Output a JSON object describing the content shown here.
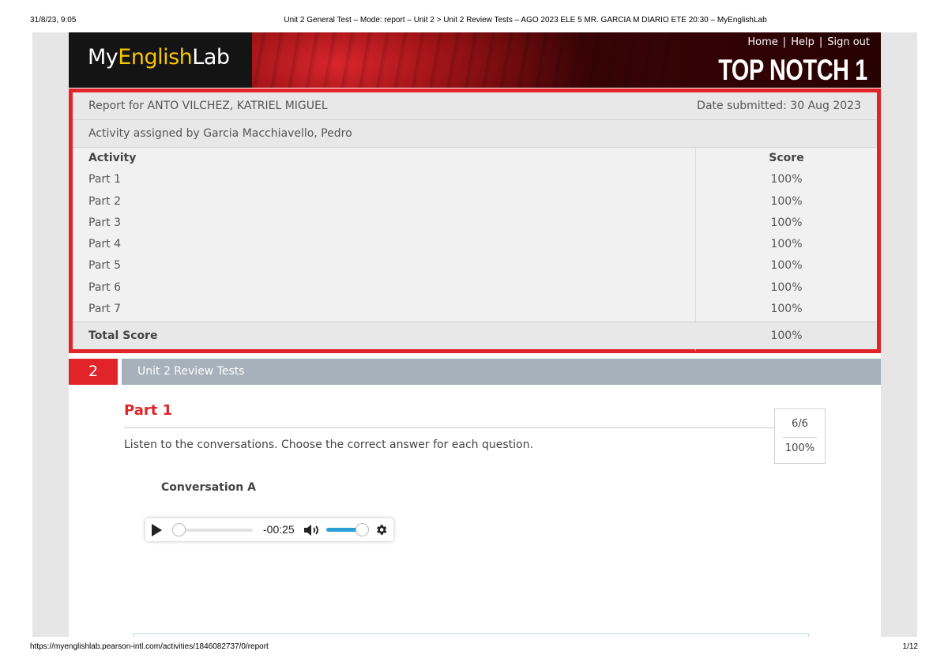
{
  "print": {
    "date": "31/8/23, 9:05",
    "title": "Unit 2 General Test – Mode: report – Unit 2 > Unit 2 Review Tests – AGO 2023 ELE 5 MR. GARCIA M DIARIO ETE 20:30 – MyEnglishLab",
    "url": "https://myenglishlab.pearson-intl.com/activities/1846082737/0/report",
    "page": "1/12"
  },
  "banner": {
    "logo_prefix": "My",
    "logo_accent": "English",
    "logo_suffix": "Lab",
    "links": [
      "Home",
      "Help",
      "Sign out"
    ],
    "separator": "|",
    "product": "TOP NOTCH 1",
    "colors": {
      "logo_accent": "#f7c600",
      "brand_red": "#e0242a"
    }
  },
  "report": {
    "student_line": "Report for ANTO VILCHEZ, KATRIEL MIGUEL",
    "date_line": "Date submitted: 30 Aug 2023",
    "assigned_line": "Activity assigned by Garcia Macchiavello, Pedro",
    "table": {
      "headers": {
        "activity": "Activity",
        "score": "Score"
      },
      "rows": [
        {
          "name": "Part 1",
          "score": "100%"
        },
        {
          "name": "Part 2",
          "score": "100%"
        },
        {
          "name": "Part 3",
          "score": "100%"
        },
        {
          "name": "Part 4",
          "score": "100%"
        },
        {
          "name": "Part 5",
          "score": "100%"
        },
        {
          "name": "Part 6",
          "score": "100%"
        },
        {
          "name": "Part 7",
          "score": "100%"
        }
      ],
      "total": {
        "name": "Total Score",
        "score": "100%"
      }
    }
  },
  "unit": {
    "number": "2",
    "title": "Unit 2 Review Tests"
  },
  "part": {
    "title": "Part 1",
    "instructions": "Listen to the conversations. Choose the correct answer for each question.",
    "score_fraction": "6/6",
    "score_percent": "100%",
    "conversation_label": "Conversation A"
  },
  "player": {
    "time": "-00:25",
    "icons": [
      "play-icon",
      "volume-icon",
      "gear-icon"
    ],
    "progress": 0,
    "volume": 1.0,
    "accent": "#2a9fd8"
  }
}
